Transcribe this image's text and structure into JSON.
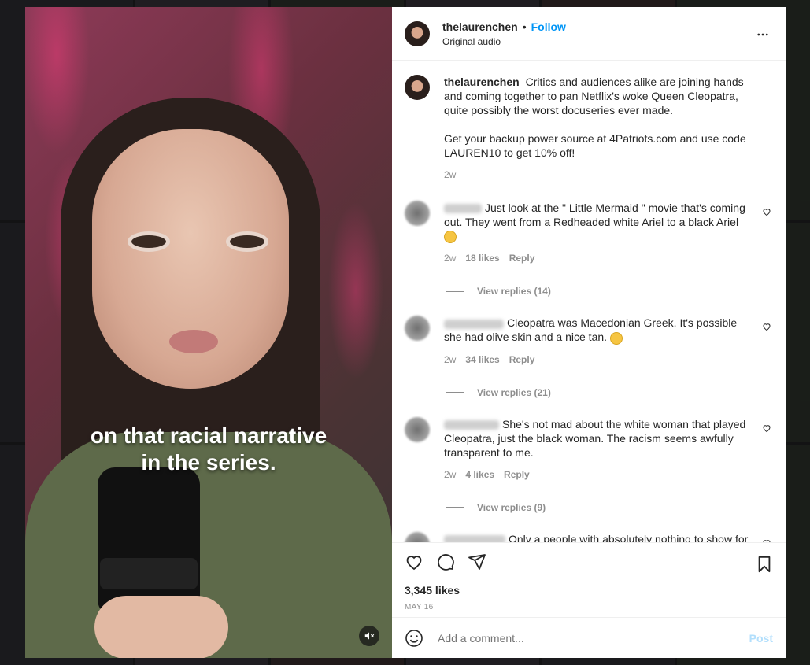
{
  "media": {
    "caption_line1": "on that racial narrative",
    "caption_line2": "in the series."
  },
  "header": {
    "username": "thelaurenchen",
    "separator": "•",
    "follow_label": "Follow",
    "audio": "Original audio"
  },
  "post_caption": {
    "username": "thelaurenchen",
    "text": "Critics and audiences alike are joining hands and coming together to pan Netflix's woke Queen Cleopatra, quite possibly the worst docuseries ever made.",
    "text2": "Get your backup power source at 4Patriots.com and use code LAUREN10 to get 10% off!",
    "time": "2w"
  },
  "comments": [
    {
      "text": "Just look at the \" Little Mermaid \" movie that's coming out. They went from a Redheaded white Ariel to a black Ariel",
      "time": "2w",
      "likes": "18 likes",
      "reply": "Reply",
      "view_replies": "View replies (14)"
    },
    {
      "text": "Cleopatra was Macedonian Greek. It's possible she had olive skin and a nice tan.",
      "time": "2w",
      "likes": "34 likes",
      "reply": "Reply",
      "view_replies": "View replies (21)"
    },
    {
      "text": "She's not mad about the white woman that played Cleopatra, just the black woman. The racism seems awfully transparent to me.",
      "time": "2w",
      "likes": "4 likes",
      "reply": "Reply",
      "view_replies": "View replies (9)"
    },
    {
      "text": "Only a people with absolutely nothing to show for themselves would want or need to claim the history of"
    }
  ],
  "actions": {
    "likes": "3,345 likes",
    "date": "MAY 16"
  },
  "add_comment": {
    "placeholder": "Add a comment...",
    "post_label": "Post"
  },
  "icons": [
    "more-icon",
    "heart-icon",
    "comment-icon",
    "share-icon",
    "bookmark-icon",
    "emoji-icon",
    "mute-icon"
  ],
  "colors": {
    "accent": "#0095f6",
    "post_disabled": "#b2dffc",
    "muted_text": "#8e8e8e"
  }
}
